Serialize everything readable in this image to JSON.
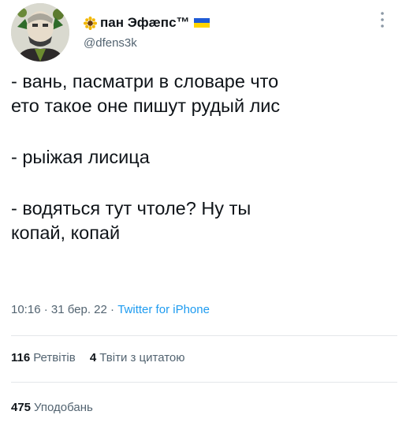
{
  "user": {
    "display_name": "пан Эфæпс™",
    "handle": "@dfens3k",
    "avatar_icon": "avatar-portrait",
    "emoji_icon": "sunflower-icon",
    "flag_icon": "ukraine-flag-icon",
    "flag_colors": [
      "#1f5bd6",
      "#ffd500"
    ]
  },
  "tweet": {
    "lines": [
      "- вань, пасматри в словаре что",
      "ето такое оне пишут рудый лис",
      "- рыiжая лисица",
      "- водяться тут чтоле? Ну ты",
      "копай, копай"
    ]
  },
  "meta": {
    "time": "10:16",
    "dot1": "·",
    "date": "31 бер. 22",
    "dot2": "·",
    "source": "Twitter for iPhone"
  },
  "stats": {
    "retweets_count": "116",
    "retweets_label": "Ретвітів",
    "quotes_count": "4",
    "quotes_label": "Твіти з цитатою",
    "likes_count": "475",
    "likes_label": "Уподобань"
  },
  "colors": {
    "text": "#0f1419",
    "muted": "#536471",
    "link": "#1d9bf0",
    "divider": "#e4e7ea"
  }
}
